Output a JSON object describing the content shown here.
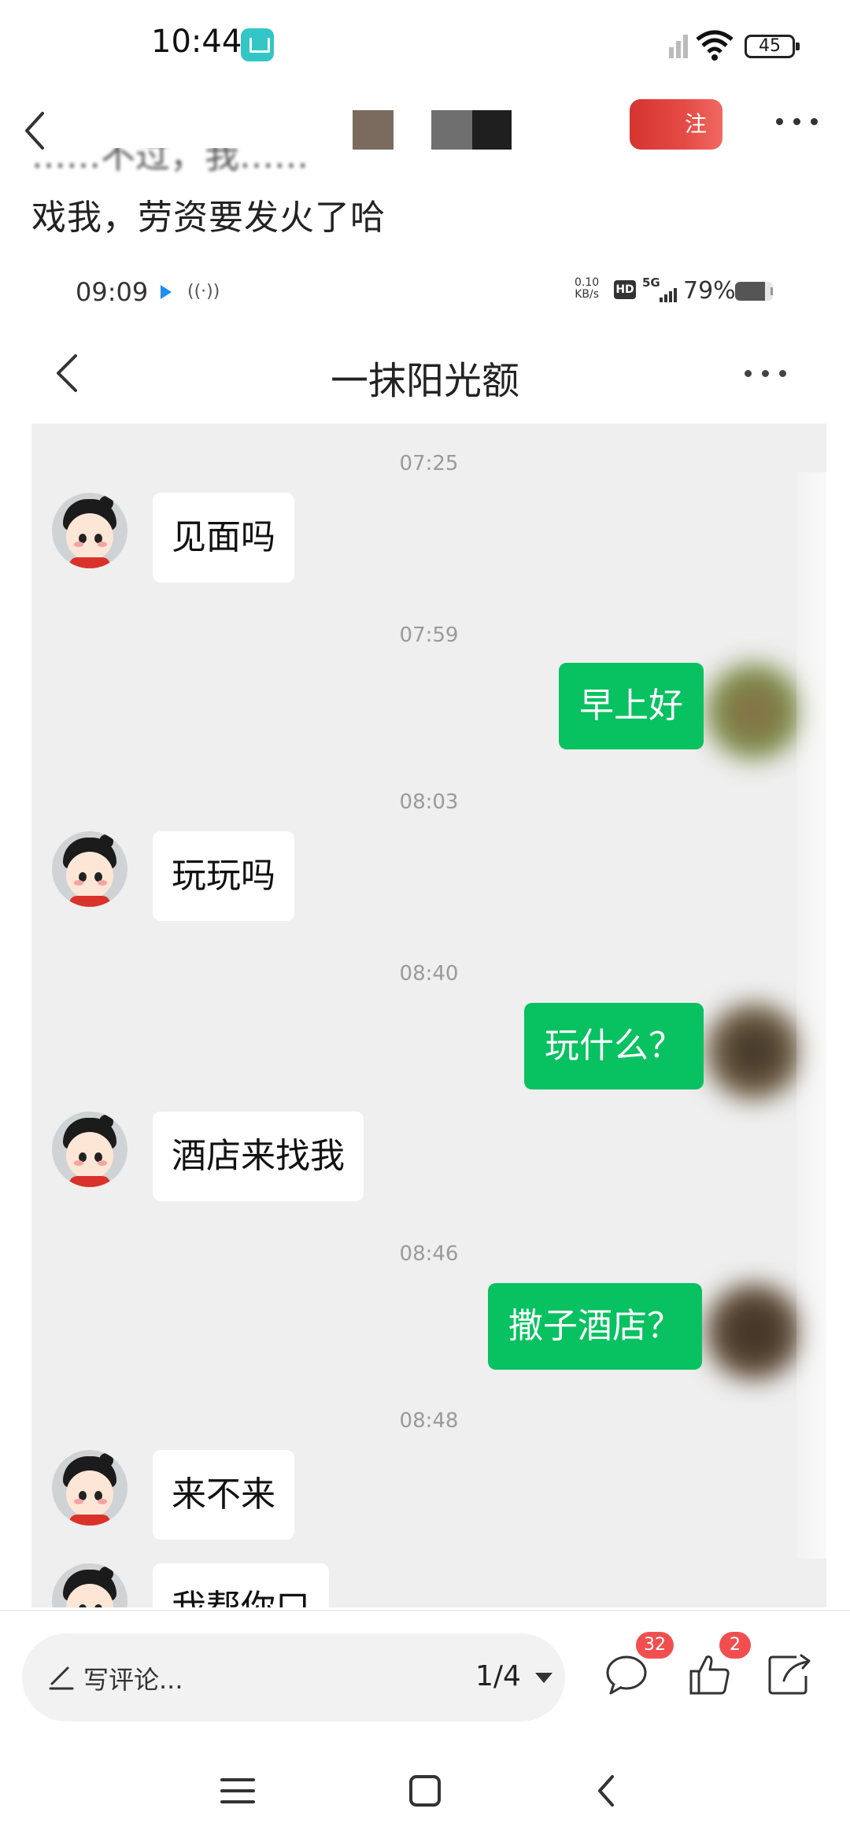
{
  "status_bar": {
    "time": "10:44",
    "battery": "45"
  },
  "app_header": {
    "follow_label": "注"
  },
  "post": {
    "text": "戏我，劳资要发火了哈",
    "partial_text_above": "……不过，我……"
  },
  "embedded_screenshot": {
    "status_bar": {
      "time": "09:09",
      "speed_value": "0.10",
      "speed_unit": "KB/s",
      "hd": "HD",
      "network": "5G",
      "battery_percent": "79%",
      "battery_level": 0.79
    },
    "chat_title": "一抹阳光额",
    "messages": [
      {
        "time": "07:25"
      },
      {
        "side": "in",
        "text": "见面吗"
      },
      {
        "time": "07:59"
      },
      {
        "side": "out",
        "text": "早上好"
      },
      {
        "time": "08:03"
      },
      {
        "side": "in",
        "text": "玩玩吗"
      },
      {
        "time": "08:40"
      },
      {
        "side": "out",
        "text": "玩什么？"
      },
      {
        "side": "in",
        "text": "酒店来找我"
      },
      {
        "time": "08:46"
      },
      {
        "side": "out",
        "text": "撒子酒店？"
      },
      {
        "time": "08:48"
      },
      {
        "side": "in",
        "text": "来不来"
      },
      {
        "side": "in",
        "text": "我帮你口"
      }
    ]
  },
  "comment_bar": {
    "placeholder": "写评论...",
    "page_indicator": "1/4",
    "comment_count": "32",
    "like_count": "2"
  },
  "icons": [
    "back-icon",
    "more-icon",
    "wifi-icon",
    "battery-icon",
    "pencil-icon",
    "comment-icon",
    "thumbs-up-icon",
    "share-icon",
    "menu-icon",
    "home-icon"
  ],
  "colors": {
    "bubble_out": "#08c160",
    "chat_bg": "#efefef",
    "badge": "#f14f4f",
    "follow": "#d6342f"
  }
}
